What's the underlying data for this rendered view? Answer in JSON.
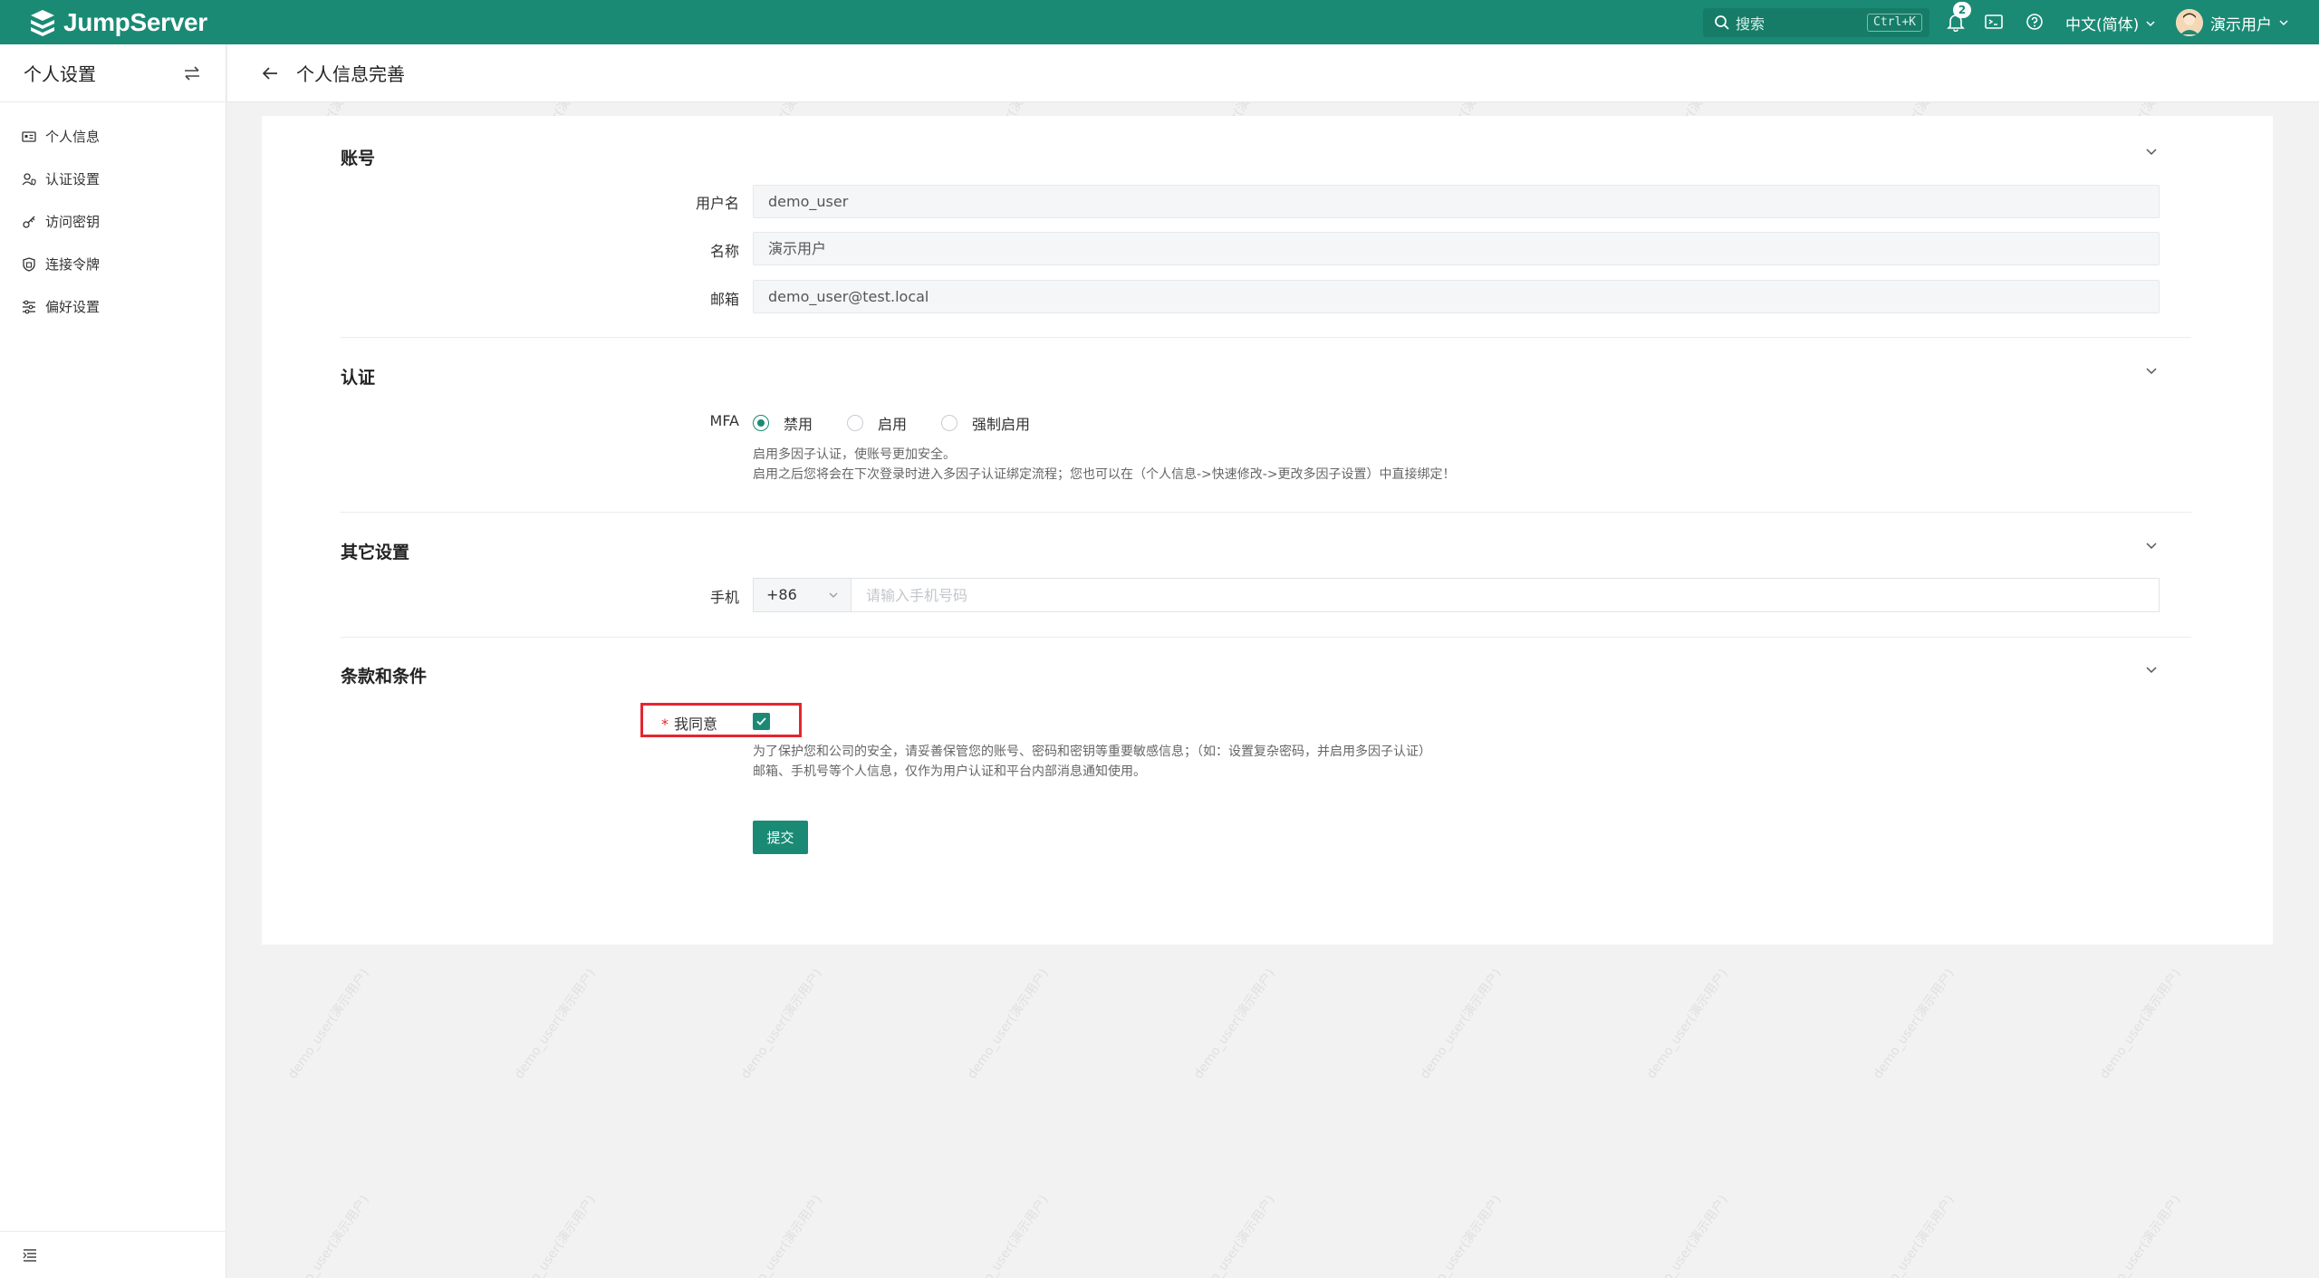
{
  "topbar": {
    "brand": "JumpServer",
    "search_placeholder": "搜索",
    "search_shortcut": "Ctrl+K",
    "notification_count": "2",
    "language": "中文(简体)",
    "user_name": "演示用户",
    "accent_color": "#1a8a75"
  },
  "sidebar": {
    "title": "个人设置",
    "items": [
      {
        "label": "个人信息",
        "icon": "id-card-icon"
      },
      {
        "label": "认证设置",
        "icon": "user-shield-icon"
      },
      {
        "label": "访问密钥",
        "icon": "key-icon"
      },
      {
        "label": "连接令牌",
        "icon": "shield-token-icon"
      },
      {
        "label": "偏好设置",
        "icon": "sliders-icon"
      }
    ]
  },
  "page": {
    "title": "个人信息完善"
  },
  "sections": {
    "account": {
      "title": "账号",
      "username_label": "用户名",
      "username_value": "demo_user",
      "name_label": "名称",
      "name_value": "演示用户",
      "email_label": "邮箱",
      "email_value": "demo_user@test.local"
    },
    "auth": {
      "title": "认证",
      "mfa_label": "MFA",
      "options": [
        "禁用",
        "启用",
        "强制启用"
      ],
      "selected": "禁用",
      "hint_1": "启用多因子认证，使账号更加安全。",
      "hint_2": "启用之后您将会在下次登录时进入多因子认证绑定流程；您也可以在（个人信息->快速修改->更改多因子设置）中直接绑定！"
    },
    "other": {
      "title": "其它设置",
      "phone_label": "手机",
      "phone_code": "+86",
      "phone_placeholder": "请输入手机号码"
    },
    "terms": {
      "title": "条款和条件",
      "required_mark": "*",
      "agree_label": "我同意",
      "agree_checked": true,
      "hint_1": "为了保护您和公司的安全，请妥善保管您的账号、密码和密钥等重要敏感信息；（如：设置复杂密码，并启用多因子认证）",
      "hint_2": "邮箱、手机号等个人信息，仅作为用户认证和平台内部消息通知使用。"
    }
  },
  "submit_label": "提交",
  "watermark_text": "demo_user(演示用户)"
}
